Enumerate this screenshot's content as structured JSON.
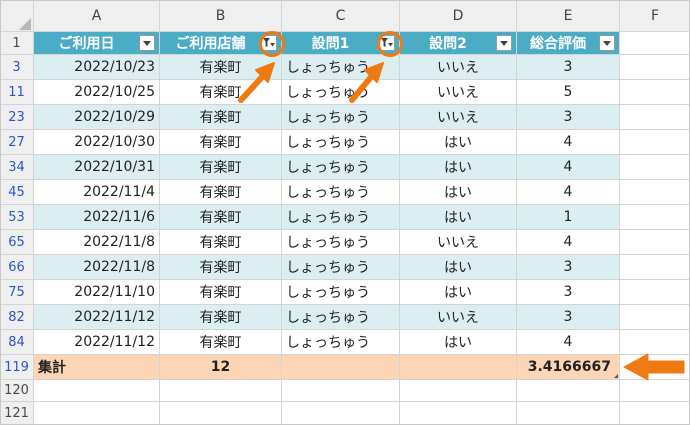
{
  "column_headers": [
    "A",
    "B",
    "C",
    "D",
    "E",
    "F"
  ],
  "header_row_num": "1",
  "table_headers": [
    "ご利用日",
    "ご利用店舗",
    "設問1",
    "設問2",
    "総合評価"
  ],
  "rows": [
    {
      "num": "3",
      "date": "2022/10/23",
      "store": "有楽町",
      "q1": "しょっちゅう",
      "q2": "いいえ",
      "score": "3"
    },
    {
      "num": "11",
      "date": "2022/10/25",
      "store": "有楽町",
      "q1": "しょっちゅう",
      "q2": "いいえ",
      "score": "5"
    },
    {
      "num": "23",
      "date": "2022/10/29",
      "store": "有楽町",
      "q1": "しょっちゅう",
      "q2": "いいえ",
      "score": "3"
    },
    {
      "num": "27",
      "date": "2022/10/30",
      "store": "有楽町",
      "q1": "しょっちゅう",
      "q2": "はい",
      "score": "4"
    },
    {
      "num": "34",
      "date": "2022/10/31",
      "store": "有楽町",
      "q1": "しょっちゅう",
      "q2": "はい",
      "score": "4"
    },
    {
      "num": "45",
      "date": "2022/11/4",
      "store": "有楽町",
      "q1": "しょっちゅう",
      "q2": "はい",
      "score": "4"
    },
    {
      "num": "53",
      "date": "2022/11/6",
      "store": "有楽町",
      "q1": "しょっちゅう",
      "q2": "はい",
      "score": "1"
    },
    {
      "num": "65",
      "date": "2022/11/8",
      "store": "有楽町",
      "q1": "しょっちゅう",
      "q2": "いいえ",
      "score": "4"
    },
    {
      "num": "66",
      "date": "2022/11/8",
      "store": "有楽町",
      "q1": "しょっちゅう",
      "q2": "はい",
      "score": "3"
    },
    {
      "num": "75",
      "date": "2022/11/10",
      "store": "有楽町",
      "q1": "しょっちゅう",
      "q2": "はい",
      "score": "3"
    },
    {
      "num": "82",
      "date": "2022/11/12",
      "store": "有楽町",
      "q1": "しょっちゅう",
      "q2": "いいえ",
      "score": "3"
    },
    {
      "num": "84",
      "date": "2022/11/12",
      "store": "有楽町",
      "q1": "しょっちゅう",
      "q2": "はい",
      "score": "4"
    }
  ],
  "total": {
    "num": "119",
    "label": "集計",
    "count": "12",
    "average": "3.4166667"
  },
  "extra_rows": [
    "120",
    "121"
  ],
  "colors": {
    "table_header": "#4bacc6",
    "band": "#dbeff3",
    "total": "#fcd5b5",
    "annotation": "#f07a12",
    "hidden_row_num": "#2b57c8"
  },
  "icons": {
    "filter_active": "filter-funnel-icon",
    "dropdown": "dropdown-arrow-icon"
  }
}
